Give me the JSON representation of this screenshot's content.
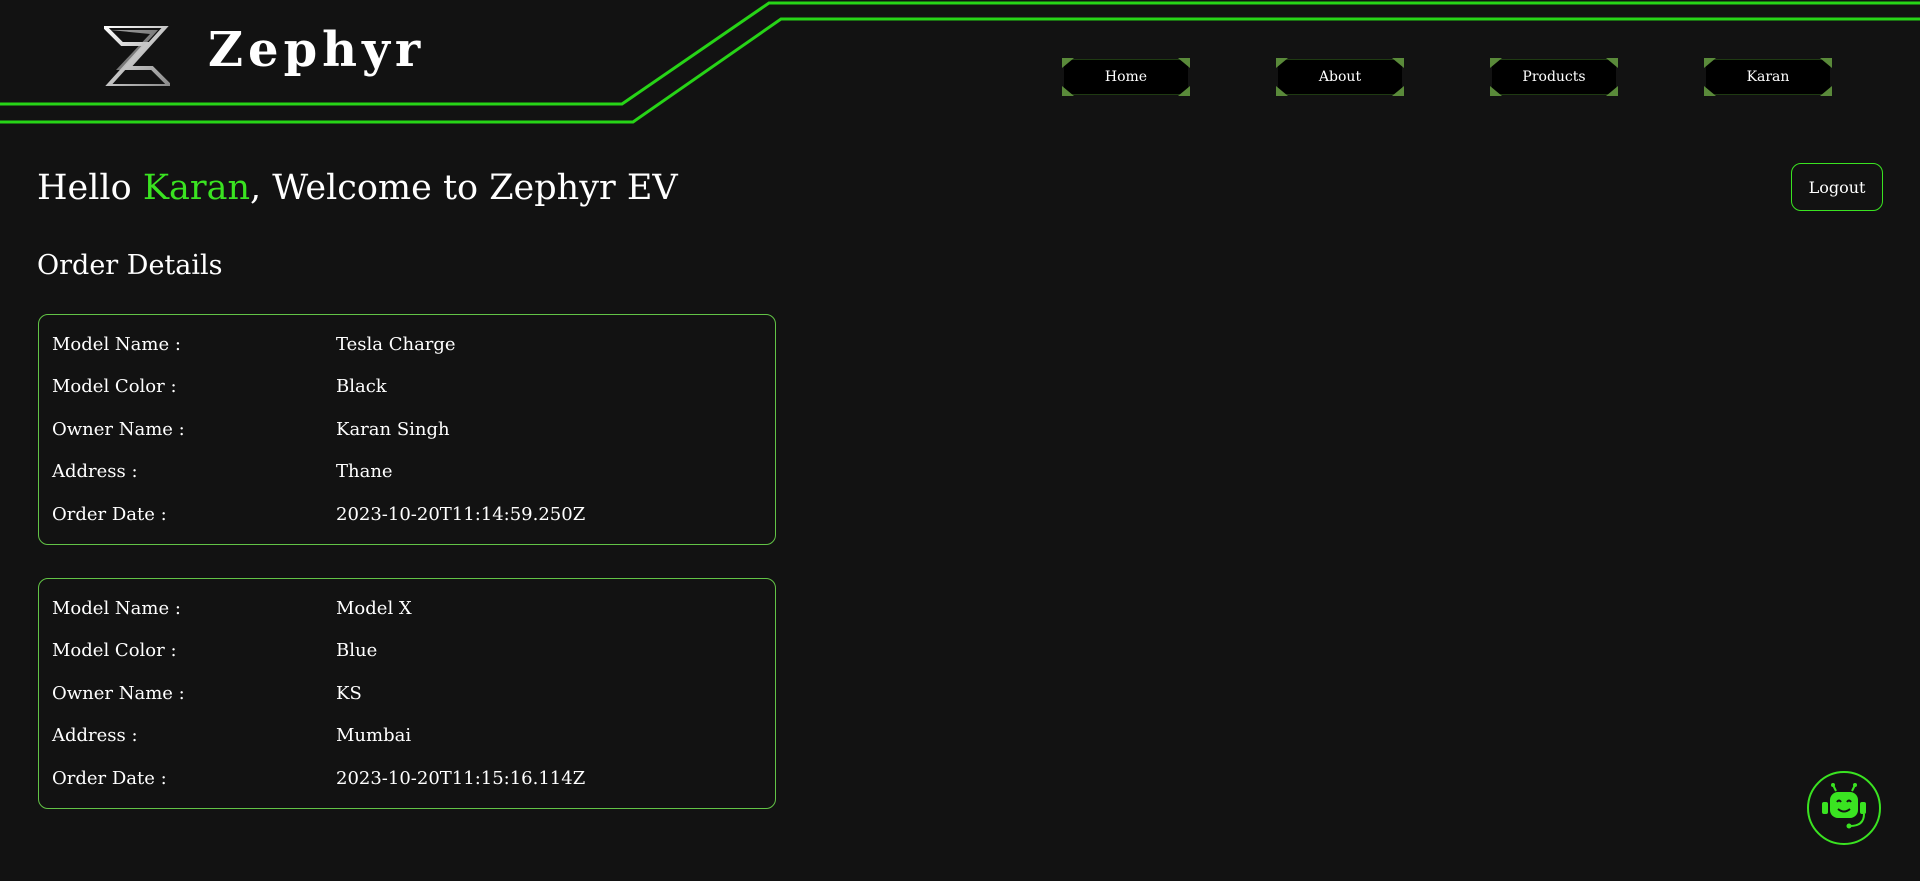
{
  "brand": {
    "name": "Zephyr",
    "logo_icon": "zephyr-z-logo-icon"
  },
  "nav": {
    "items": [
      {
        "label": "Home"
      },
      {
        "label": "About"
      },
      {
        "label": "Products"
      },
      {
        "label": "Karan"
      }
    ]
  },
  "greeting": {
    "prefix": "Hello ",
    "name": "Karan",
    "suffix": ", Welcome to Zephyr EV"
  },
  "logout_label": "Logout",
  "section_title": "Order Details",
  "orders": [
    {
      "rows": [
        {
          "label": "Model Name :",
          "value": "Tesla Charge"
        },
        {
          "label": "Model Color :",
          "value": "Black"
        },
        {
          "label": "Owner Name :",
          "value": "Karan Singh"
        },
        {
          "label": "Address :",
          "value": "Thane"
        },
        {
          "label": "Order Date :",
          "value": "2023-10-20T11:14:59.250Z"
        }
      ]
    },
    {
      "rows": [
        {
          "label": "Model Name :",
          "value": "Model X"
        },
        {
          "label": "Model Color :",
          "value": "Blue"
        },
        {
          "label": "Owner Name :",
          "value": "KS"
        },
        {
          "label": "Address :",
          "value": "Mumbai"
        },
        {
          "label": "Order Date :",
          "value": "2023-10-20T11:15:16.114Z"
        }
      ]
    }
  ],
  "chatbot_icon": "robot-chat-icon",
  "colors": {
    "background": "#121212",
    "accent": "#3ae321",
    "card_border": "#62c346",
    "text": "#ffffff"
  }
}
